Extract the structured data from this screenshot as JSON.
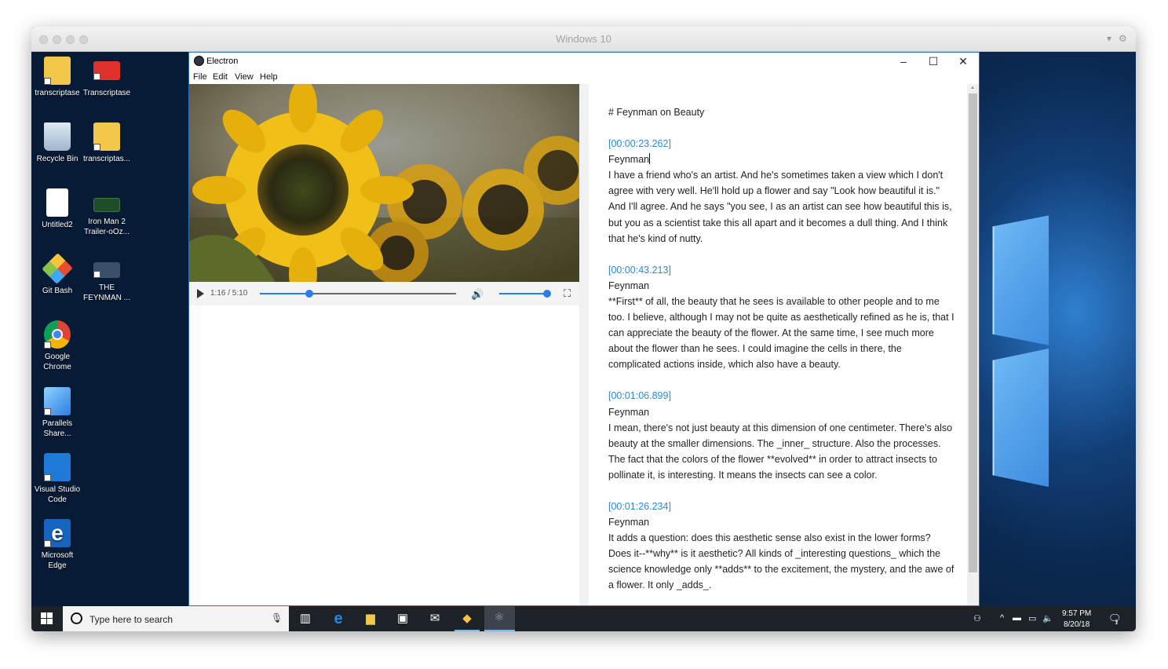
{
  "vm": {
    "title": "Windows 10"
  },
  "desktop": {
    "icons": [
      {
        "label": "transcriptase"
      },
      {
        "label": "Transcriptase"
      },
      {
        "label": "Recycle Bin"
      },
      {
        "label": "transcriptas..."
      },
      {
        "label": "Untitled2"
      },
      {
        "label": "Iron Man 2 Trailer-oOz..."
      },
      {
        "label": "Git Bash"
      },
      {
        "label": "THE FEYNMAN ..."
      },
      {
        "label": "Google Chrome"
      },
      {
        "label": "Parallels Share..."
      },
      {
        "label": "Visual Studio Code"
      },
      {
        "label": "Microsoft Edge"
      }
    ]
  },
  "app": {
    "title": "Electron",
    "menu": [
      "File",
      "Edit",
      "View",
      "Help"
    ],
    "player": {
      "time": "1:16 / 5:10",
      "progress": 0.25,
      "volume": 0.98
    },
    "transcript": {
      "heading": "# Feynman on Beauty",
      "entries": [
        {
          "timestamp": "[00:00:23.262]",
          "speaker": "Feynman",
          "text": "I have a friend who's an artist. And he's sometimes taken a view which I don't agree with very well. He'll hold up a flower and say \"Look how beautiful it is.\" And I'll agree. And he says \"you see, I as an artist can see how beautiful this is, but you as a scientist take this all apart and it becomes a dull thing. And I think that he's kind of nutty."
        },
        {
          "timestamp": "[00:00:43.213]",
          "speaker": "Feynman",
          "text": "**First** of all, the beauty that he sees is available to other people and to me too. I believe, although I may not be quite as aesthetically refined as he is, that I can appreciate the beauty of the flower. At the same time, I see much more about the flower than he sees. I could imagine the cells in there, the complicated actions inside, which also have a beauty."
        },
        {
          "timestamp": "[00:01:06.899]",
          "speaker": "Feynman",
          "text": "I mean, there's not just beauty at this dimension of one centimeter. There's also beauty at the smaller dimensions. The _inner_ structure. Also the processes. The fact that the colors of the flower **evolved** in order to attract insects to pollinate it, is interesting. It means the insects can see a color."
        },
        {
          "timestamp": "[00:01:26.234]",
          "speaker": "Feynman",
          "text": "It adds a question: does this aesthetic sense also exist in the lower forms? Does it--**why** is it aesthetic? All kinds of _interesting questions_ which the science knowledge only **adds** to the excitement, the mystery, and the awe of a flower. It only _adds_."
        }
      ]
    }
  },
  "taskbar": {
    "search_placeholder": "Type here to search",
    "clock_time": "9:57 PM",
    "clock_date": "8/20/18",
    "notification_count": "1"
  }
}
